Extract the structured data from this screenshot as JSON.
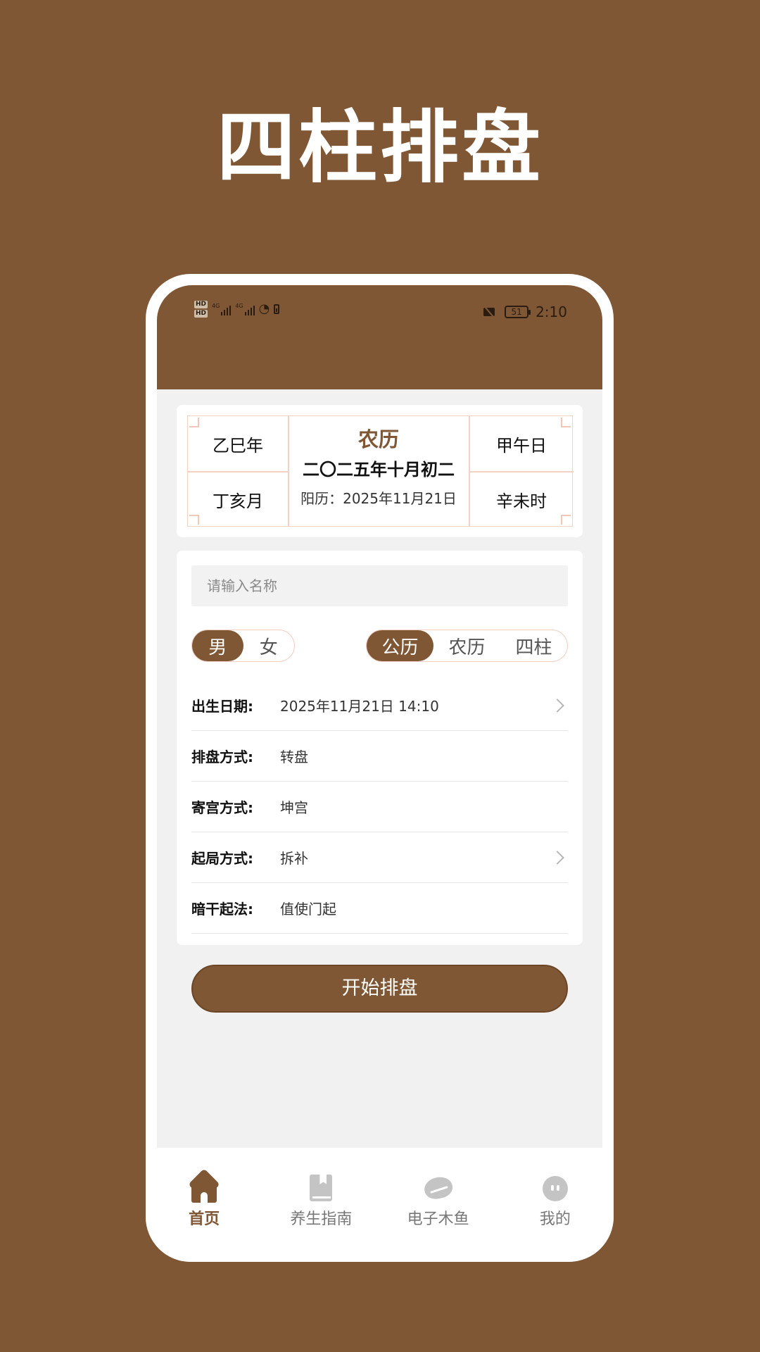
{
  "hero": {
    "title": "四柱排盘"
  },
  "status_bar": {
    "time": "2:10",
    "battery": "51",
    "hd1": "HD",
    "hd2": "HD",
    "net": "4G"
  },
  "calendar": {
    "year_pillar": "乙巳年",
    "month_pillar": "丁亥月",
    "day_pillar": "甲午日",
    "hour_pillar": "辛未时",
    "lunar_label": "农历",
    "lunar_date": "二〇二五年十月初二",
    "solar_date": "阳历：2025年11月21日"
  },
  "form": {
    "name_placeholder": "请输入名称",
    "gender_options": [
      "男",
      "女"
    ],
    "gender_selected": "男",
    "calendar_options": [
      "公历",
      "农历",
      "四柱"
    ],
    "calendar_selected": "公历",
    "rows": [
      {
        "label": "出生日期:",
        "value": "2025年11月21日 14:10",
        "has_arrow": true
      },
      {
        "label": "排盘方式:",
        "value": "转盘",
        "has_arrow": false
      },
      {
        "label": "寄宫方式:",
        "value": "坤宫",
        "has_arrow": false
      },
      {
        "label": "起局方式:",
        "value": "拆补",
        "has_arrow": true
      },
      {
        "label": "暗干起法:",
        "value": "值使门起",
        "has_arrow": false
      }
    ],
    "submit_label": "开始排盘"
  },
  "tabbar": {
    "items": [
      {
        "label": "首页",
        "icon": "home-icon",
        "active": true
      },
      {
        "label": "养生指南",
        "icon": "book-icon",
        "active": false
      },
      {
        "label": "电子木鱼",
        "icon": "wooden-fish-icon",
        "active": false
      },
      {
        "label": "我的",
        "icon": "profile-icon",
        "active": false
      }
    ]
  },
  "colors": {
    "brand": "#7f5734",
    "background": "#f1f1f1",
    "border_accent": "#f3d2c6"
  }
}
